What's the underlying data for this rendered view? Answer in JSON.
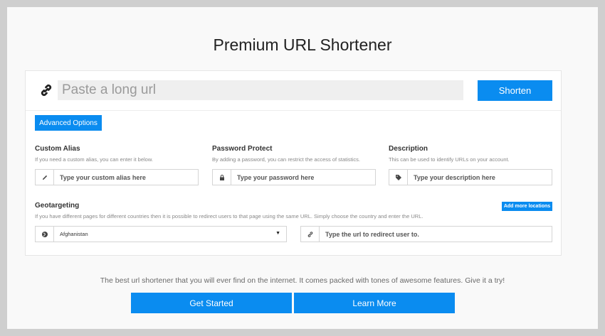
{
  "header": {
    "title": "Premium URL Shortener"
  },
  "shortener": {
    "url_placeholder": "Paste a long url",
    "shorten_label": "Shorten",
    "advanced_label": "Advanced Options"
  },
  "custom_alias": {
    "label": "Custom Alias",
    "help": "If you need a custom alias, you can enter it below.",
    "placeholder": "Type your custom alias here"
  },
  "password": {
    "label": "Password Protect",
    "help": "By adding a password, you can restrict the access of statistics.",
    "placeholder": "Type your password here"
  },
  "description": {
    "label": "Description",
    "help": "This can be used to identify URLs on your account.",
    "placeholder": "Type your description here"
  },
  "geotargeting": {
    "label": "Geotargeting",
    "help": "If you have different pages for different countries then it is possible to redirect users to that page using the same URL. Simply choose the country and enter the URL.",
    "add_more_label": "Add more locations",
    "country_selected": "Afghanistan",
    "redirect_placeholder": "Type the url to redirect user to."
  },
  "footer": {
    "tagline": "The best url shortener that you will ever find on the internet. It comes packed with tones of awesome features. Give it a try!",
    "get_started_label": "Get Started",
    "learn_more_label": "Learn More"
  },
  "colors": {
    "accent": "#0a8cf0",
    "page_bg": "#f9f9f9",
    "frame": "#cfcfcf"
  }
}
